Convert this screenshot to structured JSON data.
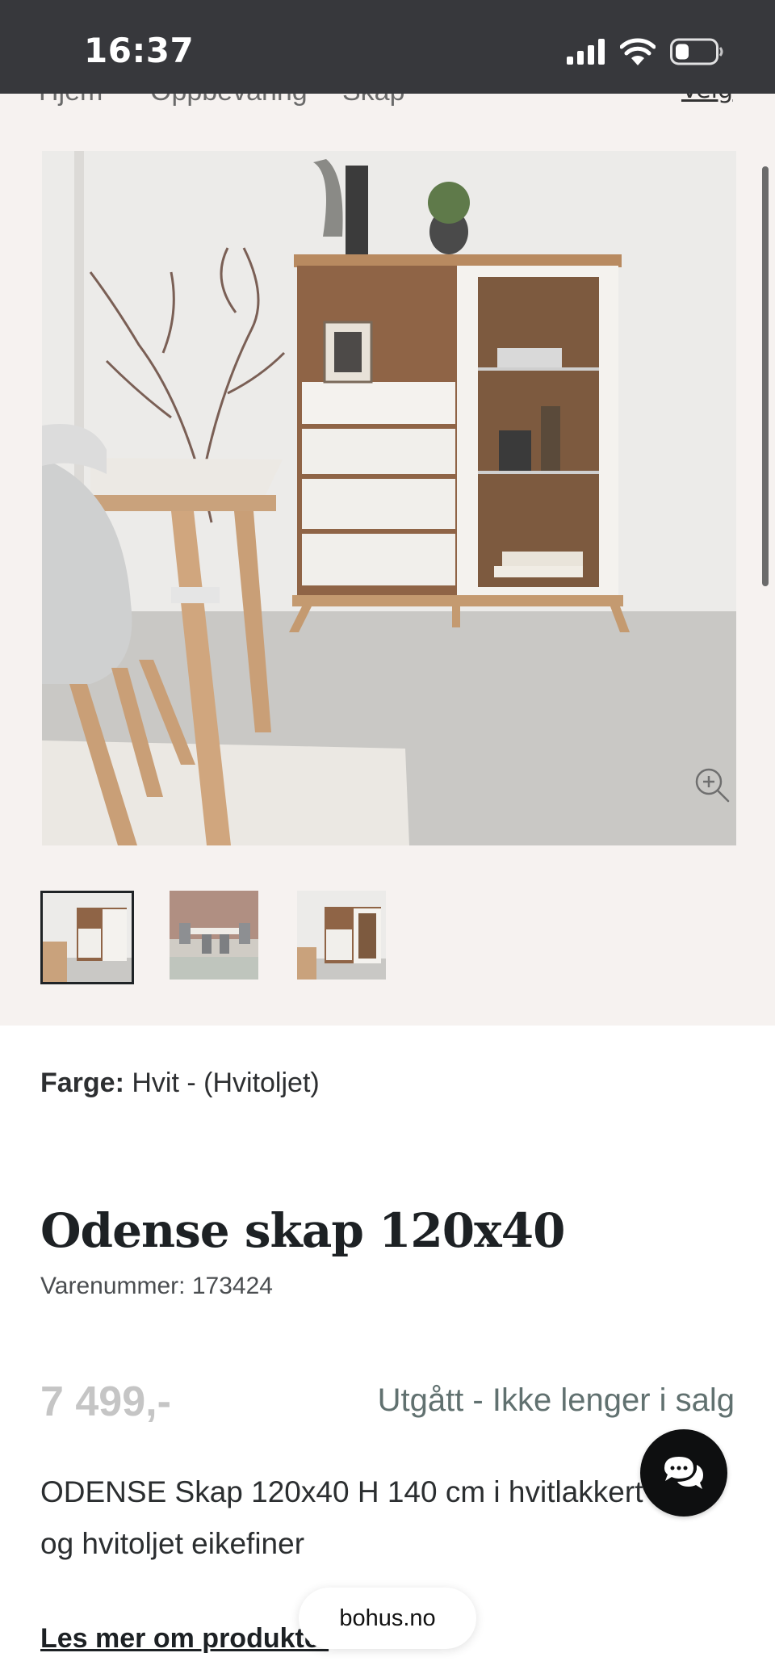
{
  "status_bar": {
    "time": "16:37",
    "icons": [
      "signal-icon",
      "wifi-icon",
      "battery-icon"
    ]
  },
  "breadcrumb": {
    "items": [
      "Hjem",
      "Oppbevaring",
      "Skap"
    ],
    "store_label": "Velg"
  },
  "gallery": {
    "thumbnail_count": 3,
    "active_thumbnail": 1
  },
  "product": {
    "color_label": "Farge:",
    "color_value": "Hvit - (Hvitoljet)",
    "title": "Odense skap 120x40",
    "sku": "Varenummer: 173424",
    "price": "7 499,-",
    "availability": "Utgått - Ikke lenger i salg",
    "description": "ODENSE Skap 120x40 H 140 cm i hvitlakkert MDF og hvitoljet eikefiner",
    "read_more": "Les mer om produktet"
  },
  "browser": {
    "url": "bohus.no"
  },
  "colors": {
    "status_bar": "#37383c",
    "gallery_bg": "#f6f2f0",
    "availability": "#617170",
    "price_disabled": "#c5c5c5"
  }
}
